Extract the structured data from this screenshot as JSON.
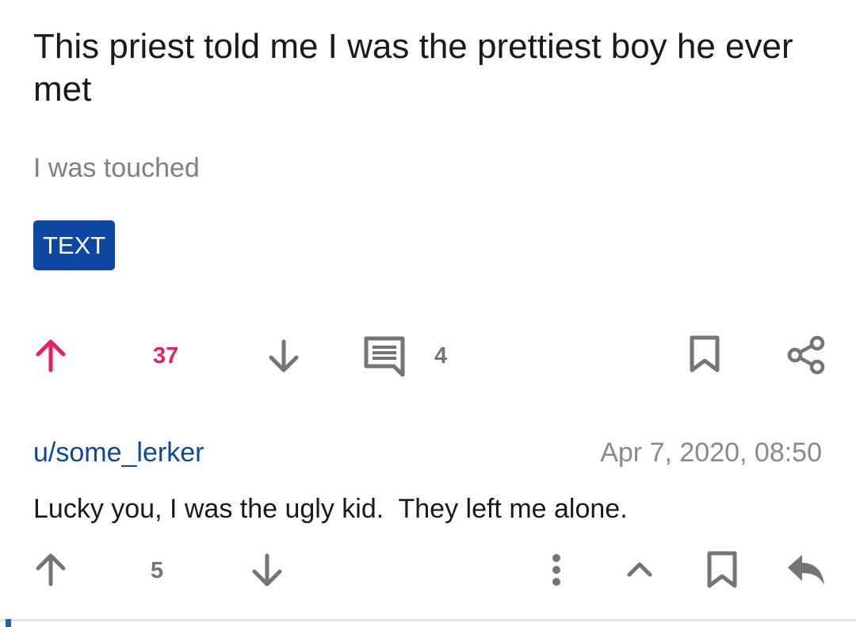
{
  "post": {
    "title": "This priest told me I was the prettiest boy he ever met",
    "body": "I was touched",
    "flair": "TEXT",
    "score": "37",
    "comment_count": "4"
  },
  "comment": {
    "author": "u/some_lerker",
    "timestamp": "Apr 7, 2020, 08:50",
    "text": "Lucky you, I was the ugly kid.  They left me alone.",
    "score": "5"
  },
  "colors": {
    "upvote_active": "#e91e63",
    "flair_bg": "#0d47a1",
    "username": "#0d47a1",
    "icon_gray": "#757575",
    "text_primary": "#1a1a1a",
    "text_secondary": "#808080"
  },
  "icons": {
    "post_upvote": "arrow-up-icon",
    "post_downvote": "arrow-down-icon",
    "comments": "comment-icon",
    "save": "bookmark-icon",
    "share": "share-icon",
    "comment_upvote": "arrow-up-icon",
    "comment_downvote": "arrow-down-icon",
    "more": "more-vertical-icon",
    "collapse": "chevron-up-icon",
    "comment_save": "bookmark-icon",
    "reply": "reply-icon"
  }
}
